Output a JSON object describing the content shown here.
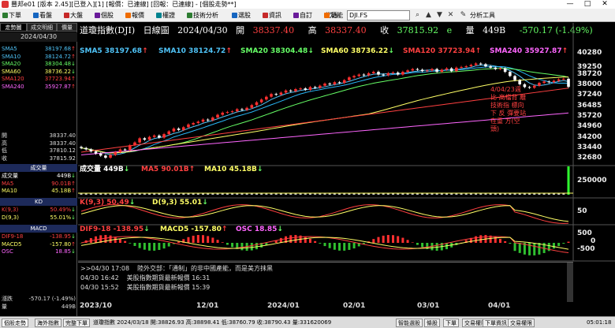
{
  "window": {
    "title": "豐邦e01 [版本 2.45][已登入][1] [報價：已連線] [回報：已連線] - [個股走勢**]",
    "controls": [
      "—",
      "□",
      "✕"
    ]
  },
  "menubar": {
    "items": [
      {
        "label": "下單",
        "icon": "order-icon",
        "color": "#2e7d32"
      },
      {
        "label": "看盤",
        "icon": "quote-icon",
        "color": "#1565c0"
      },
      {
        "label": "大盤",
        "icon": "market-icon",
        "color": "#c62828"
      },
      {
        "label": "個股",
        "icon": "stock-icon",
        "color": "#6a1b9a"
      },
      {
        "label": "報價",
        "icon": "price-icon",
        "color": "#ef6c00"
      },
      {
        "label": "權證",
        "icon": "warrant-icon",
        "color": "#00838f"
      },
      {
        "label": "技術分析",
        "icon": "ta-icon",
        "color": "#2e7d32"
      },
      {
        "label": "選股",
        "icon": "screener-icon",
        "color": "#1565c0"
      },
      {
        "label": "資訊",
        "icon": "info-icon",
        "color": "#c62828"
      },
      {
        "label": "自訂",
        "icon": "custom-icon",
        "color": "#6a1b9a"
      },
      {
        "label": "功能",
        "icon": "function-icon",
        "color": "#ef6c00"
      }
    ],
    "code_label": "代碼",
    "code_value": "DJI.FS",
    "analysis_tools": "分析工具"
  },
  "left_panel": {
    "tabs": [
      "走勢圖",
      "成交明細",
      "價量"
    ],
    "date": "2024/04/30",
    "ma_rows": [
      {
        "label": "SMA5",
        "value": "38197.68",
        "color": "#4fc3f7",
        "trend": "up"
      },
      {
        "label": "SMA10",
        "value": "38124.72",
        "color": "#4fc3f7",
        "trend": "up"
      },
      {
        "label": "SMA20",
        "value": "38304.48",
        "color": "#66ff66",
        "trend": "down"
      },
      {
        "label": "SMA60",
        "value": "38736.22",
        "color": "#ffff66",
        "trend": "down"
      },
      {
        "label": "SMA120",
        "value": "37723.94",
        "color": "#ff4040",
        "trend": "up"
      },
      {
        "label": "SMA240",
        "value": "35927.87",
        "color": "#ff66ff",
        "trend": "up"
      }
    ],
    "ohlc_rows": [
      {
        "label": "開",
        "value": "38337.40"
      },
      {
        "label": "高",
        "value": "38337.40"
      },
      {
        "label": "低",
        "value": "37810.12"
      },
      {
        "label": "收",
        "value": "37815.92"
      }
    ],
    "vol_head": "成交量",
    "vol_rows": [
      {
        "label": "成交量",
        "value": "449B",
        "color": "#ffffff",
        "trend": "down"
      },
      {
        "label": "MA5",
        "value": "90.01B",
        "color": "#ff4040",
        "trend": "up"
      },
      {
        "label": "MA10",
        "value": "45.18B",
        "color": "#ffff66",
        "trend": "up"
      }
    ],
    "kd_head": "KD",
    "kd_rows": [
      {
        "label": "K(9,3)",
        "value": "50.49%",
        "color": "#ff4040",
        "trend": "down"
      },
      {
        "label": "D(9,3)",
        "value": "55.01%",
        "color": "#ffff66",
        "trend": "down"
      }
    ],
    "macd_head": "MACD",
    "macd_rows": [
      {
        "label": "DIF9-18",
        "value": "-138.95",
        "color": "#ff4040",
        "trend": "down"
      },
      {
        "label": "MACD5",
        "value": "-157.80",
        "color": "#ffff66",
        "trend": "up"
      },
      {
        "label": "OSC",
        "value": "18.85",
        "color": "#ff66ff",
        "trend": "down"
      }
    ],
    "change_rows": [
      {
        "label": "漲跌",
        "value": "-570.17 (-1.49%)"
      },
      {
        "label": "量",
        "value": "449B"
      }
    ]
  },
  "chart_header": {
    "name": "道瓊指數(DJI)",
    "period": "日線圖",
    "date": "2024/04/30",
    "open_label": "開",
    "open_value": "38337.40",
    "high_label": "高",
    "high_value": "38337.40",
    "close_label": "收",
    "close_value": "37815.92",
    "close_suffix": "e",
    "vol_label": "量",
    "vol_value": "449B",
    "change": "-570.17 (-1.49%)"
  },
  "ma_legend": [
    {
      "text": "SMA5 38197.68",
      "color": "#4fc3f7",
      "trend": "up"
    },
    {
      "text": "SMA10 38124.72",
      "color": "#4fc3f7",
      "trend": "up"
    },
    {
      "text": "SMA20 38304.48",
      "color": "#66ff66",
      "trend": "down"
    },
    {
      "text": "SMA60 38736.22",
      "color": "#ffff66",
      "trend": "down"
    },
    {
      "text": "SMA120 37723.94",
      "color": "#ff4040",
      "trend": "up"
    },
    {
      "text": "SMA240 35927.87",
      "color": "#ff66ff",
      "trend": "up"
    }
  ],
  "price_axis": [
    "40280",
    "39250",
    "38720",
    "38000",
    "37240",
    "36485",
    "35720",
    "34960",
    "34200",
    "33440",
    "32680"
  ],
  "annotation": "4/04/23週 比 高檔背 離 技術指 標向下 反 彈要站在重 方(空頭)",
  "vol_legend": [
    {
      "text": "成交量 449B",
      "color": "#ffffff",
      "trend": "down"
    },
    {
      "text": "MA5 90.01B",
      "color": "#ff4040",
      "trend": "up"
    },
    {
      "text": "MA10 45.18B",
      "color": "#ffff66",
      "trend": "down"
    }
  ],
  "vol_axis": "250000",
  "kd_legend": [
    {
      "text": "K(9,3) 50.49",
      "color": "#ff4040",
      "trend": "down"
    },
    {
      "text": "D(9,3) 55.01",
      "color": "#ffff66",
      "trend": "down"
    }
  ],
  "kd_axis": [
    "50"
  ],
  "macd_legend": [
    {
      "text": "DIF9-18 -138.95",
      "color": "#ff4040",
      "trend": "down"
    },
    {
      "text": "MACD5 -157.80",
      "color": "#ffff66",
      "trend": "up"
    },
    {
      "text": "OSC 18.85",
      "color": "#ff66ff",
      "trend": "down"
    }
  ],
  "macd_axis": [
    "500",
    "0",
    "-500"
  ],
  "news": [
    {
      "time": ">>04/30 17:08",
      "text": "陸外交部：「通制」的非中國產能，而是美方抹黑"
    },
    {
      "time": "04/30 16:42",
      "text": "美股指數期貨最新報價 16:31"
    },
    {
      "time": "04/30 15:52",
      "text": "美股指數期貨最新報價 15:39"
    }
  ],
  "x_axis": [
    "2023/10",
    "12/01",
    "2024/01",
    "02/01",
    "03/01",
    "04/01"
  ],
  "statusbar": {
    "tabs": [
      "個股走勢",
      "海外指數",
      "完整下單"
    ],
    "quote": "道瓊指數 2024/03/18 開:38826.93 高:38898.41 低:38760.79 收:38790.43 量:331620069",
    "right_items": [
      "智能選股",
      "條股",
      "下單",
      "交易權限",
      "下單資訊",
      "交易權限"
    ],
    "time": "05:01:18"
  },
  "chart_data": {
    "type": "candlestick",
    "title": "道瓊指數(DJI) 日線圖",
    "x_ticks": [
      "2023/10",
      "12/01",
      "2024/01",
      "02/01",
      "03/01",
      "04/01"
    ],
    "y_ticks": [
      40280,
      39250,
      38720,
      38000,
      37240,
      36485,
      35720,
      34960,
      34200,
      33440,
      32680
    ],
    "ylim": [
      32300,
      40500
    ],
    "close": [
      33400,
      33300,
      33150,
      33000,
      32850,
      32700,
      32900,
      33100,
      33300,
      33250,
      33600,
      33800,
      34100,
      34000,
      34200,
      34300,
      34150,
      34400,
      34600,
      34800,
      34700,
      34900,
      35100,
      35200,
      35300,
      35450,
      35400,
      35600,
      35800,
      35950,
      36000,
      36050,
      36200,
      36150,
      36300,
      36500,
      36700,
      36900,
      37100,
      37300,
      37250,
      37400,
      37550,
      37500,
      37650,
      37700,
      37600,
      37800,
      37750,
      37900,
      38050,
      38000,
      38150,
      38100,
      38300,
      38500,
      38600,
      38700,
      38650,
      38800,
      38900,
      38700,
      38650,
      38800,
      38850,
      38700,
      38900,
      39000,
      39100,
      39050,
      38950,
      39000,
      39100,
      38900,
      39050,
      39150,
      38950,
      39200,
      39250,
      39300,
      39400,
      39500,
      39450,
      39300,
      39200,
      39100,
      39150,
      38900,
      38600,
      38300,
      38000,
      37800,
      37750,
      37900,
      38100,
      38200,
      38150,
      38250,
      38350,
      38400,
      37815
    ],
    "sma": [
      {
        "name": "SMA5",
        "last": 38197.68
      },
      {
        "name": "SMA10",
        "last": 38124.72
      },
      {
        "name": "SMA20",
        "last": 38304.48
      },
      {
        "name": "SMA60",
        "last": 38736.22
      },
      {
        "name": "SMA120",
        "last": 37723.94
      },
      {
        "name": "SMA240",
        "last": 35927.87
      }
    ],
    "volume_last": "449B",
    "kd": {
      "K": 50.49,
      "D": 55.01
    },
    "macd": {
      "DIF": -138.95,
      "MACD": -157.8,
      "OSC": 18.85
    }
  }
}
